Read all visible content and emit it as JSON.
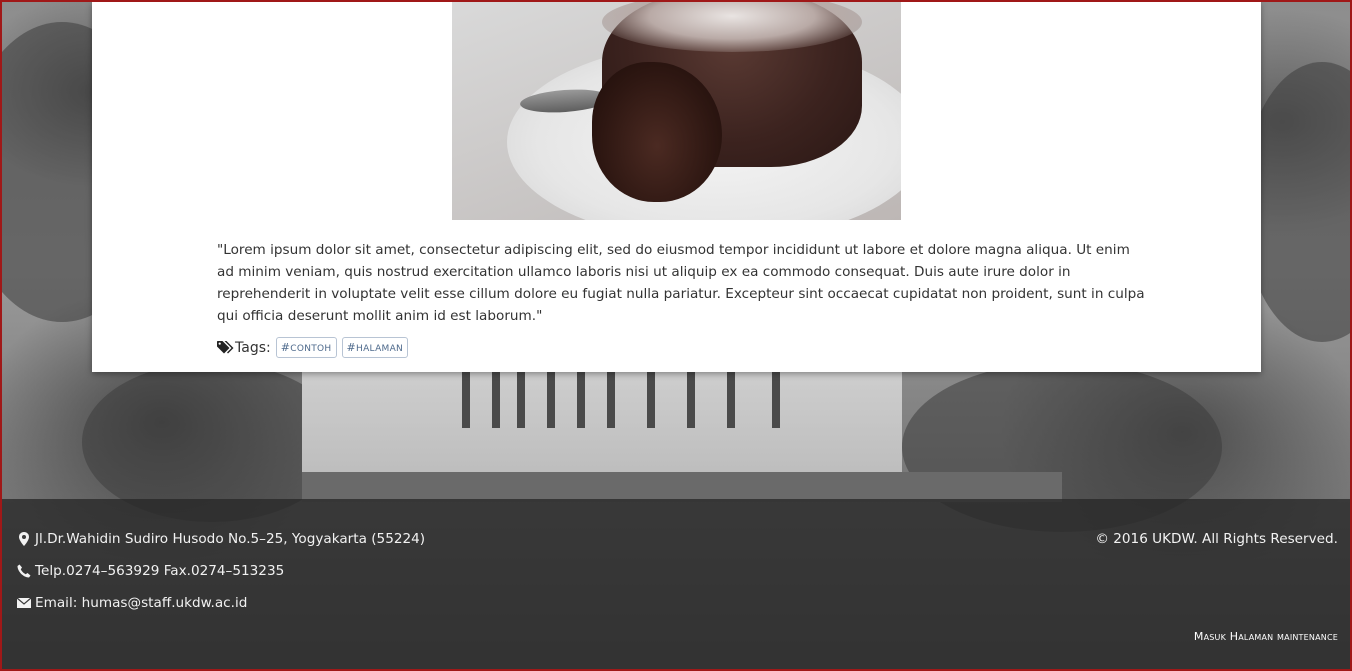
{
  "article": {
    "image_alt": "chocolate lava cake",
    "body": "\"Lorem ipsum dolor sit amet, consectetur adipiscing elit, sed do eiusmod tempor incididunt ut labore et dolore magna aliqua. Ut enim ad minim veniam, quis nostrud exercitation ullamco laboris nisi ut aliquip ex ea commodo consequat. Duis aute irure dolor in reprehenderit in voluptate velit esse cillum dolore eu fugiat nulla pariatur. Excepteur sint occaecat cupidatat non proident, sunt in culpa qui officia deserunt mollit anim id est laborum.\"",
    "tags_label": "Tags:",
    "tags": [
      "contoh",
      "halaman"
    ],
    "tag_prefix": "#"
  },
  "footer": {
    "address": "Jl.Dr.Wahidin Sudiro Husodo No.5–25, Yogyakarta (55224)",
    "phone": "Telp.0274–563929 Fax.0274–513235",
    "email": "Email: humas@staff.ukdw.ac.id",
    "copyright": "© 2016 UKDW. All Rights Reserved.",
    "maintenance_link": "Masuk Halaman maintenance"
  },
  "icons": {
    "address": "map-marker-icon",
    "phone": "phone-icon",
    "email": "envelope-icon",
    "tags": "tags-icon"
  },
  "colors": {
    "frame_border": "#a01818",
    "tag_text": "#4e6a8c",
    "footer_bg": "#282828"
  }
}
